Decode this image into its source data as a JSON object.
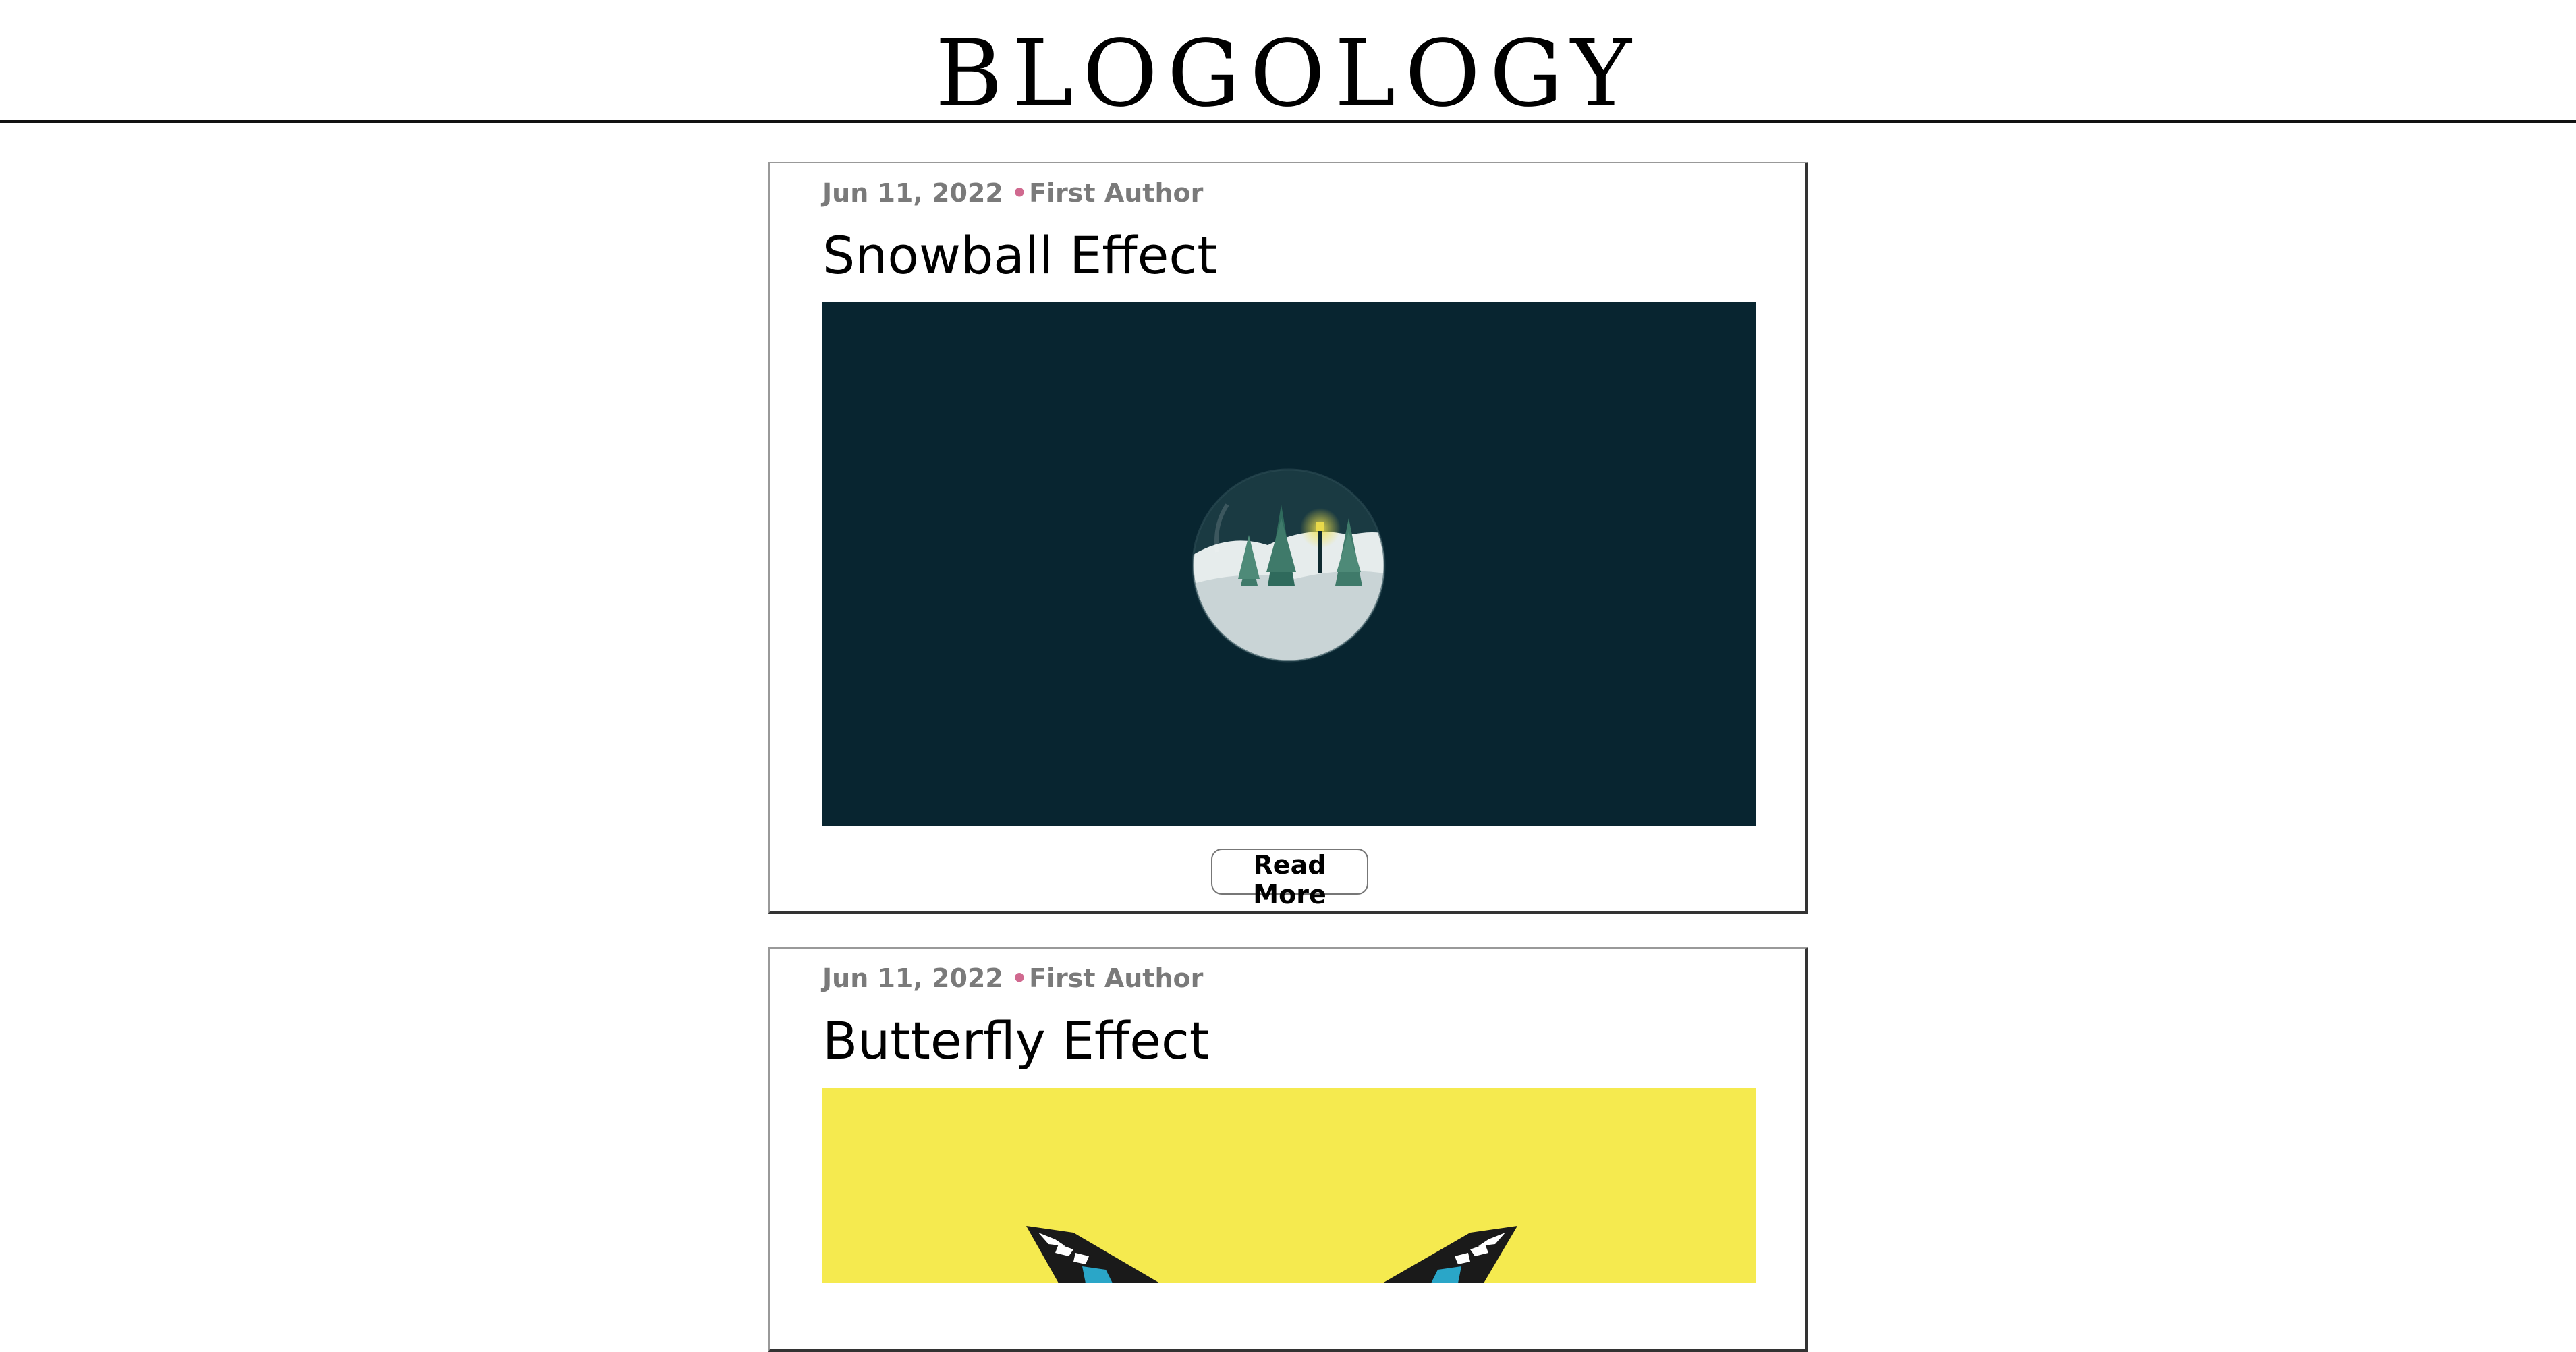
{
  "site": {
    "title": "BLOGOLOGY"
  },
  "posts": [
    {
      "date": "Jun 11, 2022",
      "separator": "•",
      "author": "First Author",
      "title": "Snowball Effect",
      "image_icon": "snow-globe",
      "image_background": "#082530",
      "read_more_label": "Read More"
    },
    {
      "date": "Jun 11, 2022",
      "separator": "•",
      "author": "First Author",
      "title": "Butterfly Effect",
      "image_icon": "butterfly",
      "image_background": "#f5ea4f"
    }
  ],
  "colors": {
    "accent_dot": "#d0698f",
    "meta_text": "#7a7a7a",
    "header_rule": "#111111"
  }
}
